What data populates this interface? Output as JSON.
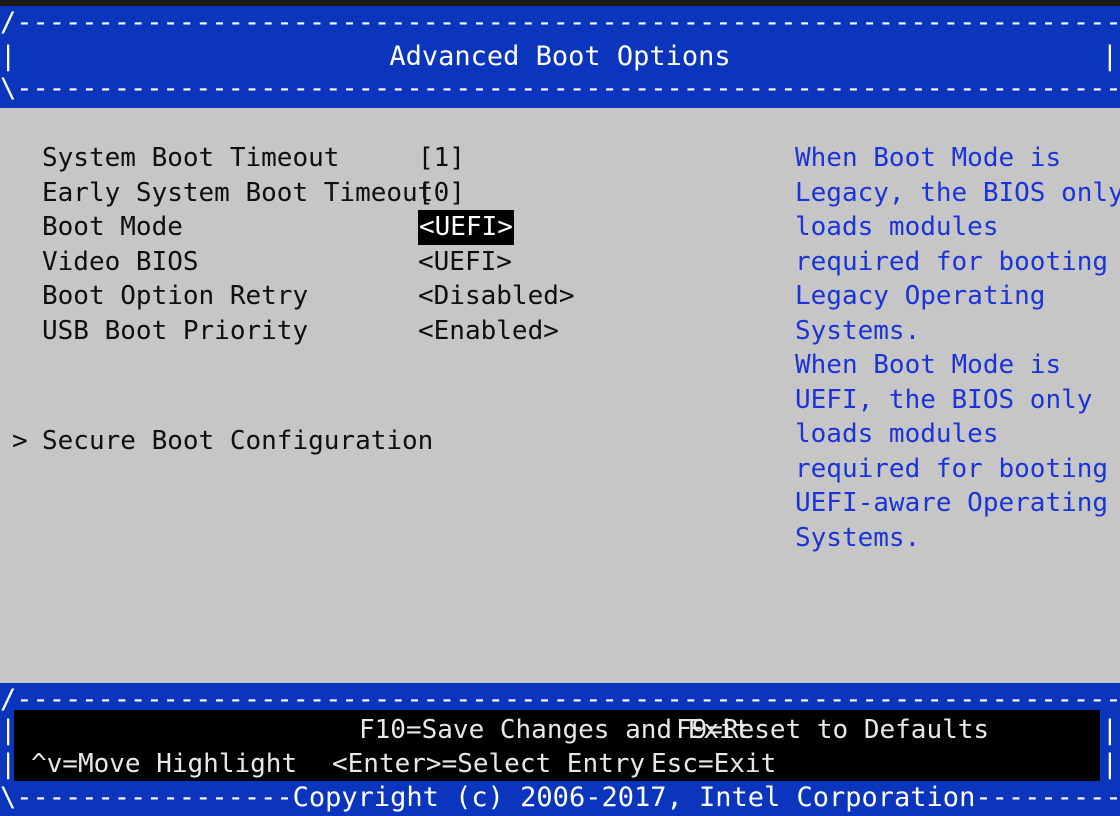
{
  "colors": {
    "frame_blue": "#0b35bd",
    "body_gray": "#c6c6c6",
    "help_text_blue": "#1a34d8",
    "highlight_bg": "#000000",
    "highlight_fg": "#ffffff",
    "menu_text": "#0f0f0f",
    "key_text": "#e8e8e8"
  },
  "header": {
    "title": "Advanced Boot Options",
    "top_rule": "/--------------------------------------------------------------------------\\",
    "bottom_rule": "\\--------------------------------------------------------------------------/",
    "side_left": "|",
    "side_right": "|"
  },
  "menu": {
    "items": [
      {
        "marker": "",
        "label": "System Boot Timeout",
        "value": "[1]",
        "highlighted": false
      },
      {
        "marker": "",
        "label": "Early System Boot Timeout",
        "value": "[0]",
        "highlighted": false
      },
      {
        "marker": "",
        "label": "Boot Mode",
        "value": "<UEFI>",
        "highlighted": true
      },
      {
        "marker": "",
        "label": "Video BIOS",
        "value": "<UEFI>",
        "highlighted": false
      },
      {
        "marker": "",
        "label": "Boot Option Retry",
        "value": "<Disabled>",
        "highlighted": false
      },
      {
        "marker": "",
        "label": "USB Boot Priority",
        "value": "<Enabled>",
        "highlighted": false
      }
    ],
    "submenu": {
      "marker": ">",
      "label": "Secure Boot Configuration",
      "value": ""
    }
  },
  "help": {
    "lines": [
      "When Boot Mode is",
      "Legacy, the BIOS only",
      "loads modules",
      "required for booting",
      "Legacy Operating",
      "Systems.",
      "When Boot Mode is",
      "UEFI, the BIOS only",
      "loads modules",
      "required for booting",
      "UEFI-aware Operating",
      "Systems."
    ]
  },
  "footer": {
    "top_rule": "/--------------------------------------------------------------------------\\",
    "side_left": "|",
    "side_right": "|",
    "keys_row1": {
      "save": "F10=Save Changes and Exit",
      "reset": "F9=Reset to Defaults"
    },
    "keys_row2": {
      "move": "^v=Move Highlight",
      "select": "<Enter>=Select Entry",
      "exit": "Esc=Exit"
    },
    "copyright_rule": "\\-----------------Copyright (c) 2006-2017, Intel Corporation------------------/"
  }
}
